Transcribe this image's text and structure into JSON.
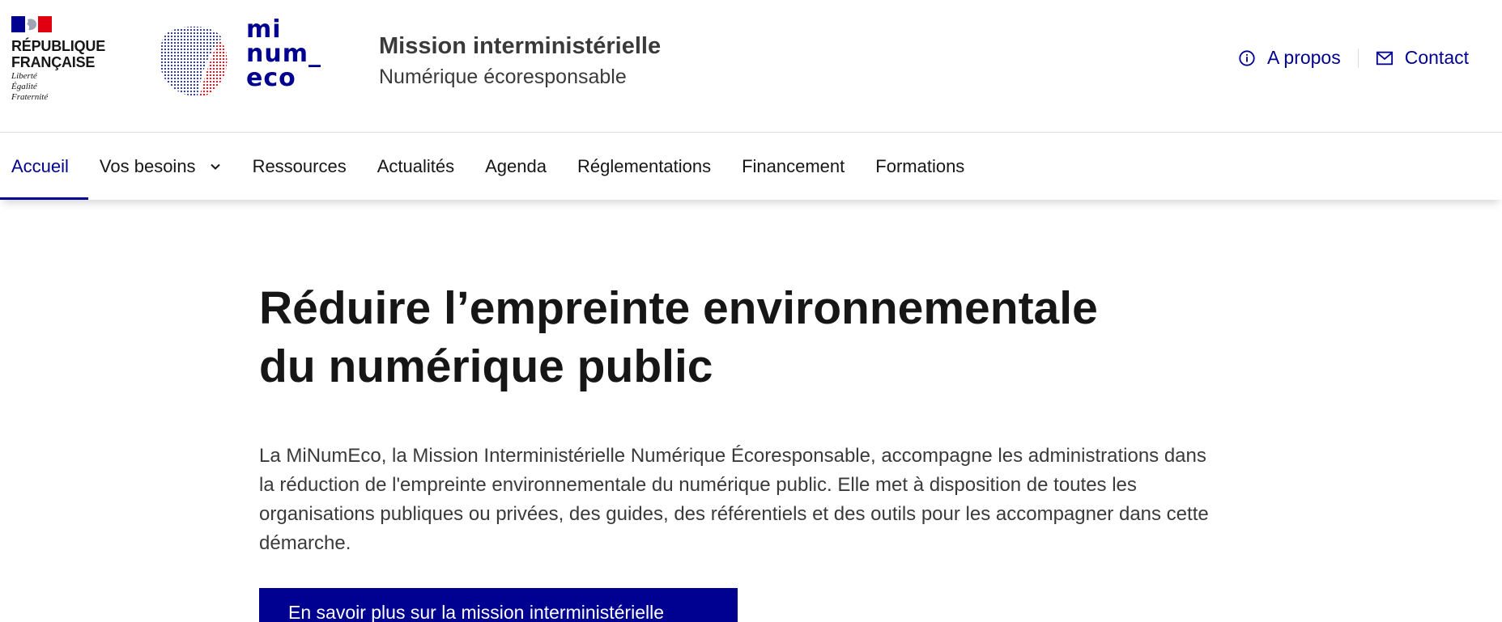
{
  "header": {
    "republique": {
      "name_line1": "RÉPUBLIQUE",
      "name_line2": "FRANÇAISE",
      "motto": [
        "Liberté",
        "Égalité",
        "Fraternité"
      ]
    },
    "brand_logo": {
      "line1": "mi",
      "line2": "num_",
      "line3": "eco"
    },
    "service_title": "Mission interministérielle",
    "service_tagline": "Numérique écoresponsable",
    "quick_links": [
      {
        "label": "A propos",
        "icon": "info-icon"
      },
      {
        "label": "Contact",
        "icon": "mail-icon"
      }
    ]
  },
  "nav": {
    "items": [
      {
        "label": "Accueil",
        "active": true
      },
      {
        "label": "Vos besoins",
        "has_dropdown": true
      },
      {
        "label": "Ressources"
      },
      {
        "label": "Actualités"
      },
      {
        "label": "Agenda"
      },
      {
        "label": "Réglementations"
      },
      {
        "label": "Financement"
      },
      {
        "label": "Formations"
      }
    ]
  },
  "hero": {
    "title_line1": "Réduire l’empreinte environnementale",
    "title_line2": "du numérique public",
    "text": "La MiNumEco, la Mission Interministérielle Numérique Écoresponsable, accompagne les administrations dans la réduction de l'empreinte environnementale du numérique public. Elle met à disposition de toutes les organisations publiques ou privées, des guides, des référentiels et des outils pour les accompagner dans cette démarche.",
    "cta_label": "En savoir plus sur la mission interministérielle"
  },
  "colors": {
    "accent": "#000091",
    "marianne_red": "#e1000f",
    "text": "#161616",
    "text_muted": "#3a3a3a"
  }
}
